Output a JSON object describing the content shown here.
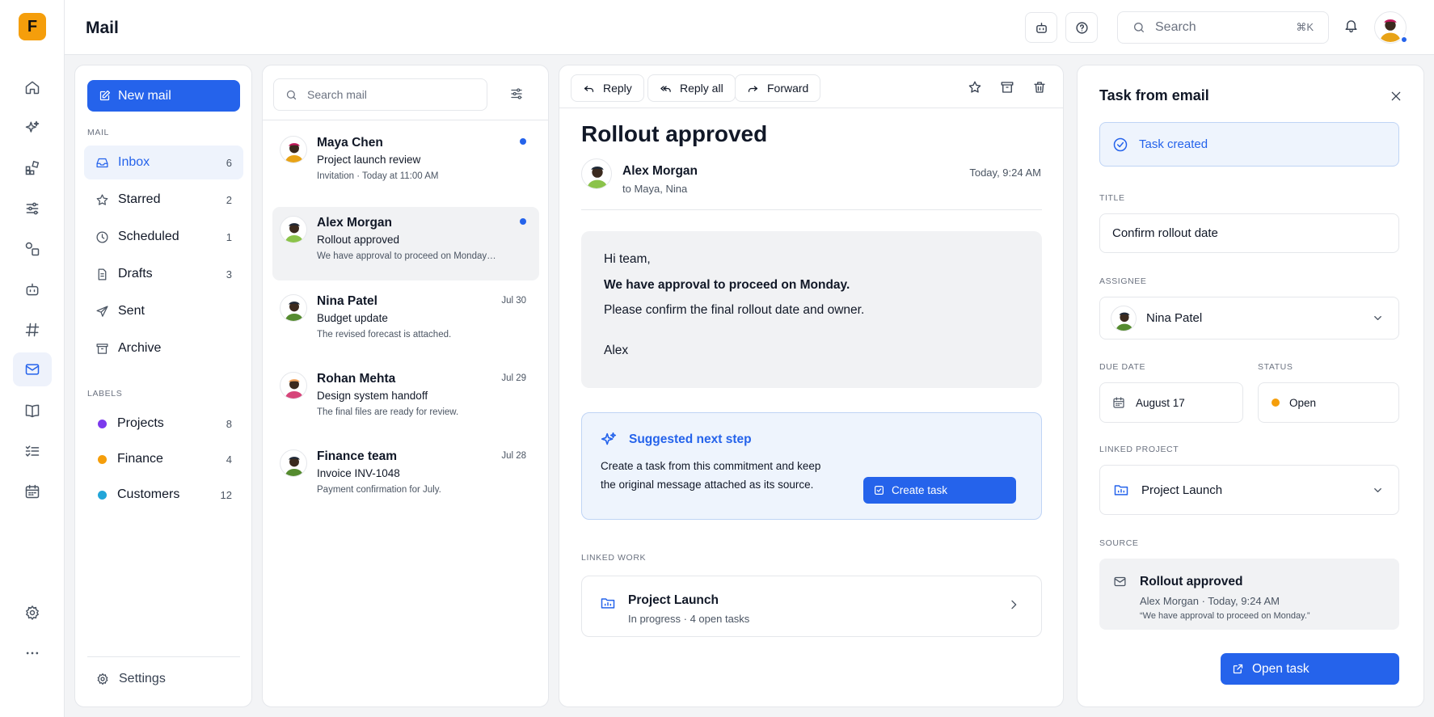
{
  "app": {
    "logo_letter": "F",
    "page_title": "Mail"
  },
  "rail": {
    "items": [
      "home-icon",
      "sparkles-icon",
      "apps-icon",
      "sliders-icon",
      "shapes-icon",
      "bot-icon",
      "hash-icon",
      "mail-icon",
      "book-icon",
      "checklist-icon",
      "calendar-icon",
      "gear-icon",
      "more-icon"
    ],
    "active": "mail-icon"
  },
  "topbar": {
    "search_placeholder": "Search",
    "search_shortcut": "⌘K"
  },
  "folders": {
    "new_mail_label": "New mail",
    "mail_section_label": "MAIL",
    "items": [
      {
        "label": "Inbox",
        "count": "6"
      },
      {
        "label": "Starred",
        "count": "2"
      },
      {
        "label": "Scheduled",
        "count": "1"
      },
      {
        "label": "Drafts",
        "count": "3"
      },
      {
        "label": "Sent",
        "count": ""
      },
      {
        "label": "Archive",
        "count": ""
      }
    ],
    "labels_section_label": "LABELS",
    "labels": [
      {
        "label": "Projects",
        "count": "8",
        "color": "#7c3aed"
      },
      {
        "label": "Finance",
        "count": "4",
        "color": "#f59e0b"
      },
      {
        "label": "Customers",
        "count": "12",
        "color": "#22a5d8"
      }
    ],
    "settings_label": "Settings"
  },
  "list": {
    "search_placeholder": "Search mail",
    "messages": [
      {
        "from": "Maya Chen",
        "subject": "Project launch review",
        "preview": "Invitation · Today at 11:00 AM",
        "date": "",
        "unread": true,
        "selected": false
      },
      {
        "from": "Alex Morgan",
        "subject": "Rollout approved",
        "preview": "We have approval to proceed on Monday…",
        "date": "",
        "unread": true,
        "selected": true
      },
      {
        "from": "Nina Patel",
        "subject": "Budget update",
        "preview": "The revised forecast is attached.",
        "date": "Jul 30",
        "unread": false,
        "selected": false
      },
      {
        "from": "Rohan Mehta",
        "subject": "Design system handoff",
        "preview": "The final files are ready for review.",
        "date": "Jul 29",
        "unread": false,
        "selected": false
      },
      {
        "from": "Finance team",
        "subject": "Invoice INV-1048",
        "preview": "Payment confirmation for July.",
        "date": "Jul 28",
        "unread": false,
        "selected": false
      }
    ]
  },
  "reader": {
    "toolbar": {
      "reply": "Reply",
      "reply_all": "Reply all",
      "forward": "Forward"
    },
    "title": "Rollout approved",
    "sender": "Alex Morgan",
    "recipients": "to Maya, Nina",
    "time": "Today, 9:24 AM",
    "body": {
      "greeting": "Hi team,",
      "bold_line": "We have approval to proceed on Monday.",
      "line": "Please confirm the final rollout date and owner.",
      "signoff": "Alex"
    },
    "suggestion": {
      "title": "Suggested next step",
      "description": "Create a task from this commitment and keep the original message attached as its source.",
      "button": "Create task"
    },
    "linked_work_label": "LINKED WORK",
    "linked_work": {
      "name": "Project Launch",
      "status": "In progress · 4 open tasks"
    }
  },
  "task": {
    "title": "Task from email",
    "created_banner": "Task created",
    "title_label": "TITLE",
    "title_value": "Confirm rollout date",
    "assignee_label": "ASSIGNEE",
    "assignee_value": "Nina Patel",
    "due_label": "DUE DATE",
    "due_value": "August 17",
    "status_label": "STATUS",
    "status_value": "Open",
    "status_color": "#f59e0b",
    "project_label": "LINKED PROJECT",
    "project_value": "Project Launch",
    "source_label": "SOURCE",
    "source": {
      "title": "Rollout approved",
      "meta": "Alex Morgan · Today, 9:24 AM",
      "quote": "“We have approval to proceed on Monday.”"
    },
    "open_button": "Open task"
  },
  "colors": {
    "accent": "#2563eb",
    "logo": "#f59e0b"
  }
}
